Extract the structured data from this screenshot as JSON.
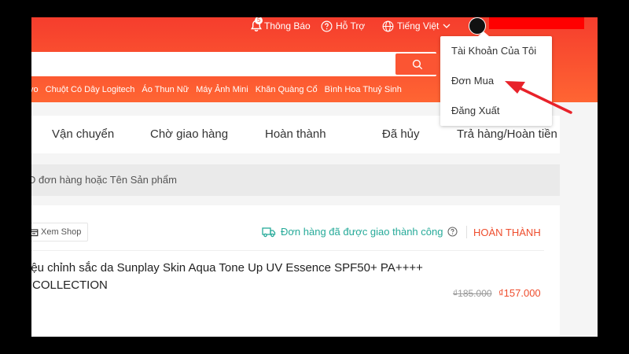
{
  "header": {
    "notifications_label": "Thông Báo",
    "notifications_count": "5",
    "help_label": "Hỗ Trợ",
    "language_label": "Tiếng Việt"
  },
  "search": {
    "suggestions": [
      "vo",
      "Chuột Có Dây Logitech",
      "Áo Thun Nữ",
      "Máy Ảnh Mini",
      "Khăn Quàng Cổ",
      "Bình Hoa Thuỷ Sinh"
    ]
  },
  "account_menu": {
    "items": [
      "Tài Khoản Của Tôi",
      "Đơn Mua",
      "Đăng Xuất"
    ]
  },
  "order_tabs": [
    "Vận chuyển",
    "Chờ giao hàng",
    "Hoàn thành",
    "Đã hủy",
    "Trả hàng/Hoàn tiền"
  ],
  "order_search": {
    "placeholder": "D đơn hàng hoặc Tên Sản phẩm"
  },
  "order": {
    "view_shop_label": "Xem Shop",
    "delivery_status": "Đơn hàng đã được giao thành công",
    "status": "HOÀN THÀNH",
    "product_name_line1": "iệu chỉnh sắc da Sunplay Skin Aqua Tone Up UV Essence SPF50+ PA++++",
    "product_name_line2": "COLLECTION",
    "price_original": "₫185.000",
    "price_current": "₫157.000"
  },
  "colors": {
    "brand": "#ee4d2d",
    "success": "#26aa99",
    "annotation_arrow": "#e8222a"
  }
}
